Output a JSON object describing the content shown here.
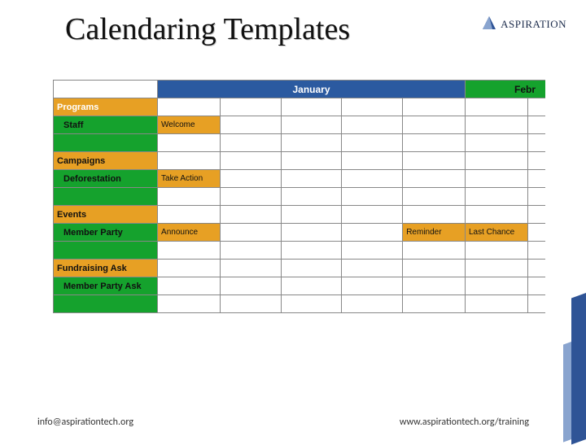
{
  "title": "Calendaring Templates",
  "logo": {
    "text": "ASPIRATION"
  },
  "months": {
    "jan": "January",
    "feb": "Febr"
  },
  "sections": {
    "programs": "Programs",
    "campaigns": "Campaigns",
    "events": "Events",
    "fundraising": "Fundraising Ask"
  },
  "rows": {
    "staff": "Staff",
    "deforestation": "Deforestation",
    "member_party": "Member Party",
    "member_party_ask": "Member Party Ask"
  },
  "cells": {
    "welcome": "Welcome",
    "take_action": "Take Action",
    "announce": "Announce",
    "reminder": "Reminder",
    "last_chance": "Last Chance"
  },
  "footer": {
    "left": "info@aspirationtech.org",
    "right": "www.aspirationtech.org/training"
  }
}
